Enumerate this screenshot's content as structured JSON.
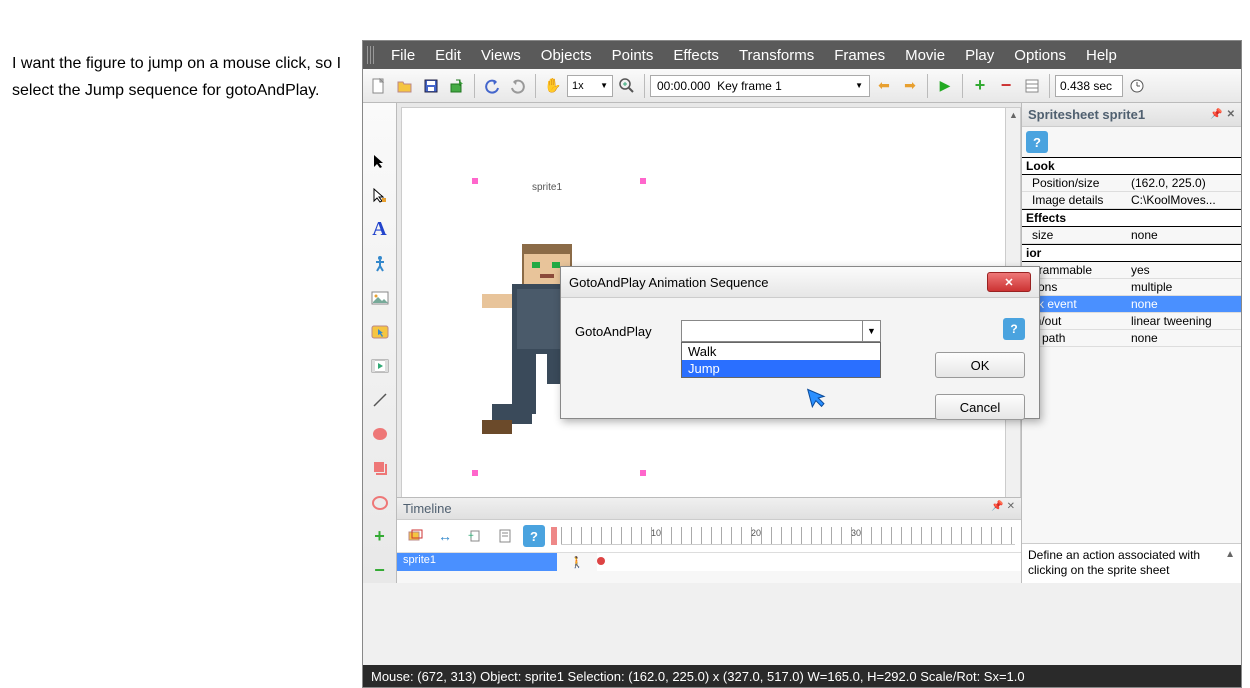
{
  "instruction": "I want the figure to jump on a mouse click, so I select the Jump sequence for gotoAndPlay.",
  "menubar": [
    "File",
    "Edit",
    "Views",
    "Objects",
    "Points",
    "Effects",
    "Transforms",
    "Frames",
    "Movie",
    "Play",
    "Options",
    "Help"
  ],
  "toolbar": {
    "zoom": "1x",
    "frame_time": "00:00.000",
    "frame_label": "Key frame 1",
    "duration": "0.438 sec"
  },
  "canvas": {
    "sprite_label": "sprite1"
  },
  "props_panel": {
    "title": "Spritesheet sprite1",
    "groups": [
      {
        "name": "Look",
        "rows": [
          {
            "k": "Position/size",
            "v": "(162.0, 225.0)"
          },
          {
            "k": "Image details",
            "v": "C:\\KoolMoves..."
          }
        ]
      },
      {
        "name": "Effects",
        "rows": [
          {
            "k": "size",
            "v": "none"
          }
        ]
      },
      {
        "name": "ior",
        "rows": [
          {
            "k": "grammable",
            "v": "yes"
          },
          {
            "k": "tions",
            "v": "multiple"
          },
          {
            "k": "ck event",
            "v": "none",
            "sel": true
          },
          {
            "k": "in/out",
            "v": "linear tweening"
          },
          {
            "k": "n path",
            "v": "none"
          }
        ]
      }
    ],
    "hint": "Define an action associated with clicking on the sprite sheet"
  },
  "timeline": {
    "title": "Timeline",
    "row_label": "sprite1",
    "ticks": [
      "10",
      "20",
      "30"
    ]
  },
  "statusbar": "Mouse: (672, 313)  Object: sprite1  Selection: (162.0, 225.0) x (327.0, 517.0)  W=165.0,  H=292.0  Scale/Rot: Sx=1.0",
  "dialog": {
    "title": "GotoAndPlay Animation Sequence",
    "label": "GotoAndPlay",
    "options": [
      "Walk",
      "Jump"
    ],
    "highlighted": "Jump",
    "ok": "OK",
    "cancel": "Cancel"
  }
}
